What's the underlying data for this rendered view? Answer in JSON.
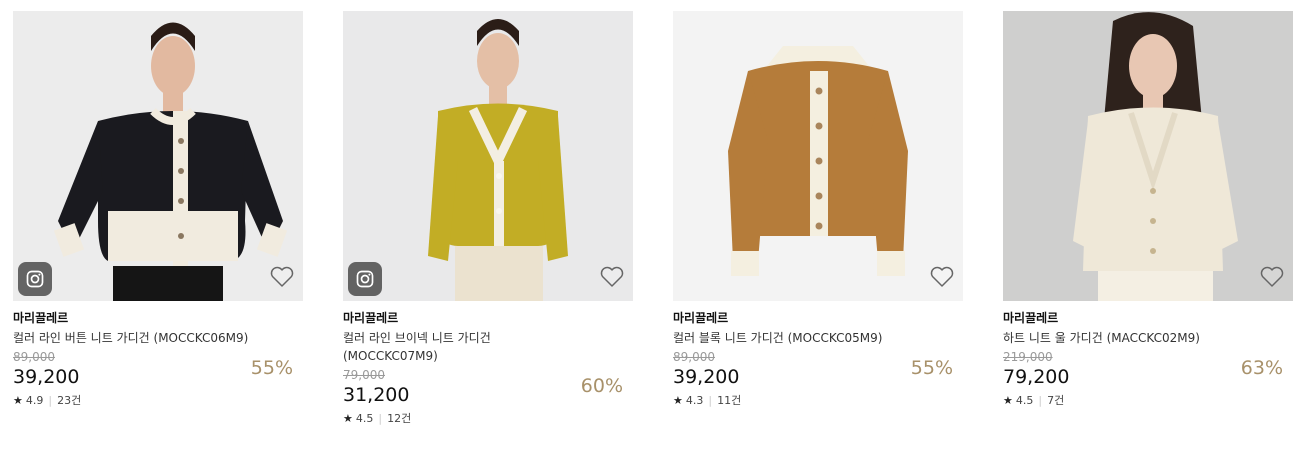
{
  "products": [
    {
      "brand": "마리끌레르",
      "title": "컬러 라인 버튼 니트 가디건 (MOCCKC06M9)",
      "original_price": "89,000",
      "sale_price": "39,200",
      "discount": "55%",
      "rating": "4.9",
      "reviews": "23건",
      "has_instagram": true,
      "swatch": "#1c1c20",
      "icons": [
        "instagram-icon",
        "heart-icon",
        "star-icon"
      ]
    },
    {
      "brand": "마리끌레르",
      "title": "컬러 라인 브이넥 니트 가디건 (MOCCKC07M9)",
      "original_price": "79,000",
      "sale_price": "31,200",
      "discount": "60%",
      "rating": "4.5",
      "reviews": "12건",
      "has_instagram": true,
      "swatch": "#c9b42a",
      "icons": [
        "instagram-icon",
        "heart-icon",
        "star-icon"
      ]
    },
    {
      "brand": "마리끌레르",
      "title": "컬러 블록 니트 가디건 (MOCCKC05M9)",
      "original_price": "89,000",
      "sale_price": "39,200",
      "discount": "55%",
      "rating": "4.3",
      "reviews": "11건",
      "has_instagram": false,
      "swatch": "#b07a36",
      "icons": [
        "heart-icon",
        "star-icon"
      ]
    },
    {
      "brand": "마리끌레르",
      "title": "하트 니트 울 가디건 (MACCKC02M9)",
      "original_price": "219,000",
      "sale_price": "79,200",
      "discount": "63%",
      "rating": "4.5",
      "reviews": "7건",
      "has_instagram": false,
      "swatch": "#efe8d8",
      "icons": [
        "heart-icon",
        "star-icon"
      ]
    }
  ],
  "colors": {
    "discount": "#a8916a",
    "original_price": "#9a9a9a"
  }
}
